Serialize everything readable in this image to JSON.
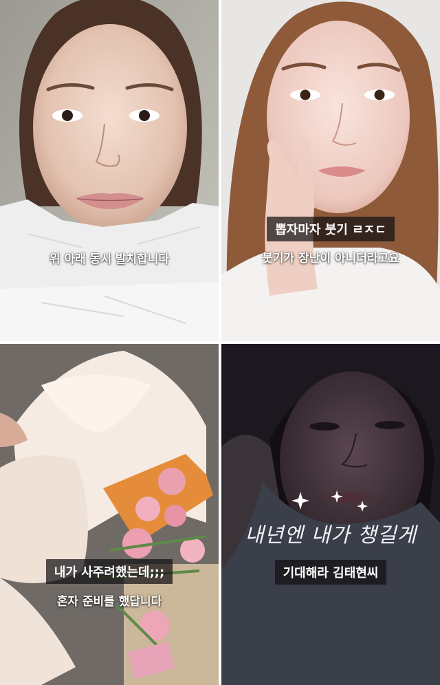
{
  "panels": [
    {
      "id": "extraction-photo",
      "captions": [
        "위 아래 동시 발치합니다"
      ]
    },
    {
      "id": "swelling-photo",
      "captions": [
        "뽑자마자 붓기 ㄹㅈㄷ",
        "붓기가 장난이 아니더라고요"
      ]
    },
    {
      "id": "bouquet-photo",
      "captions": [
        "내가 사주려했는데;;;",
        "혼자 준비를 했답니다"
      ]
    },
    {
      "id": "night-photo",
      "captions": [
        "내년엔 내가 챙길게",
        "기대해라 김태현씨"
      ]
    }
  ]
}
